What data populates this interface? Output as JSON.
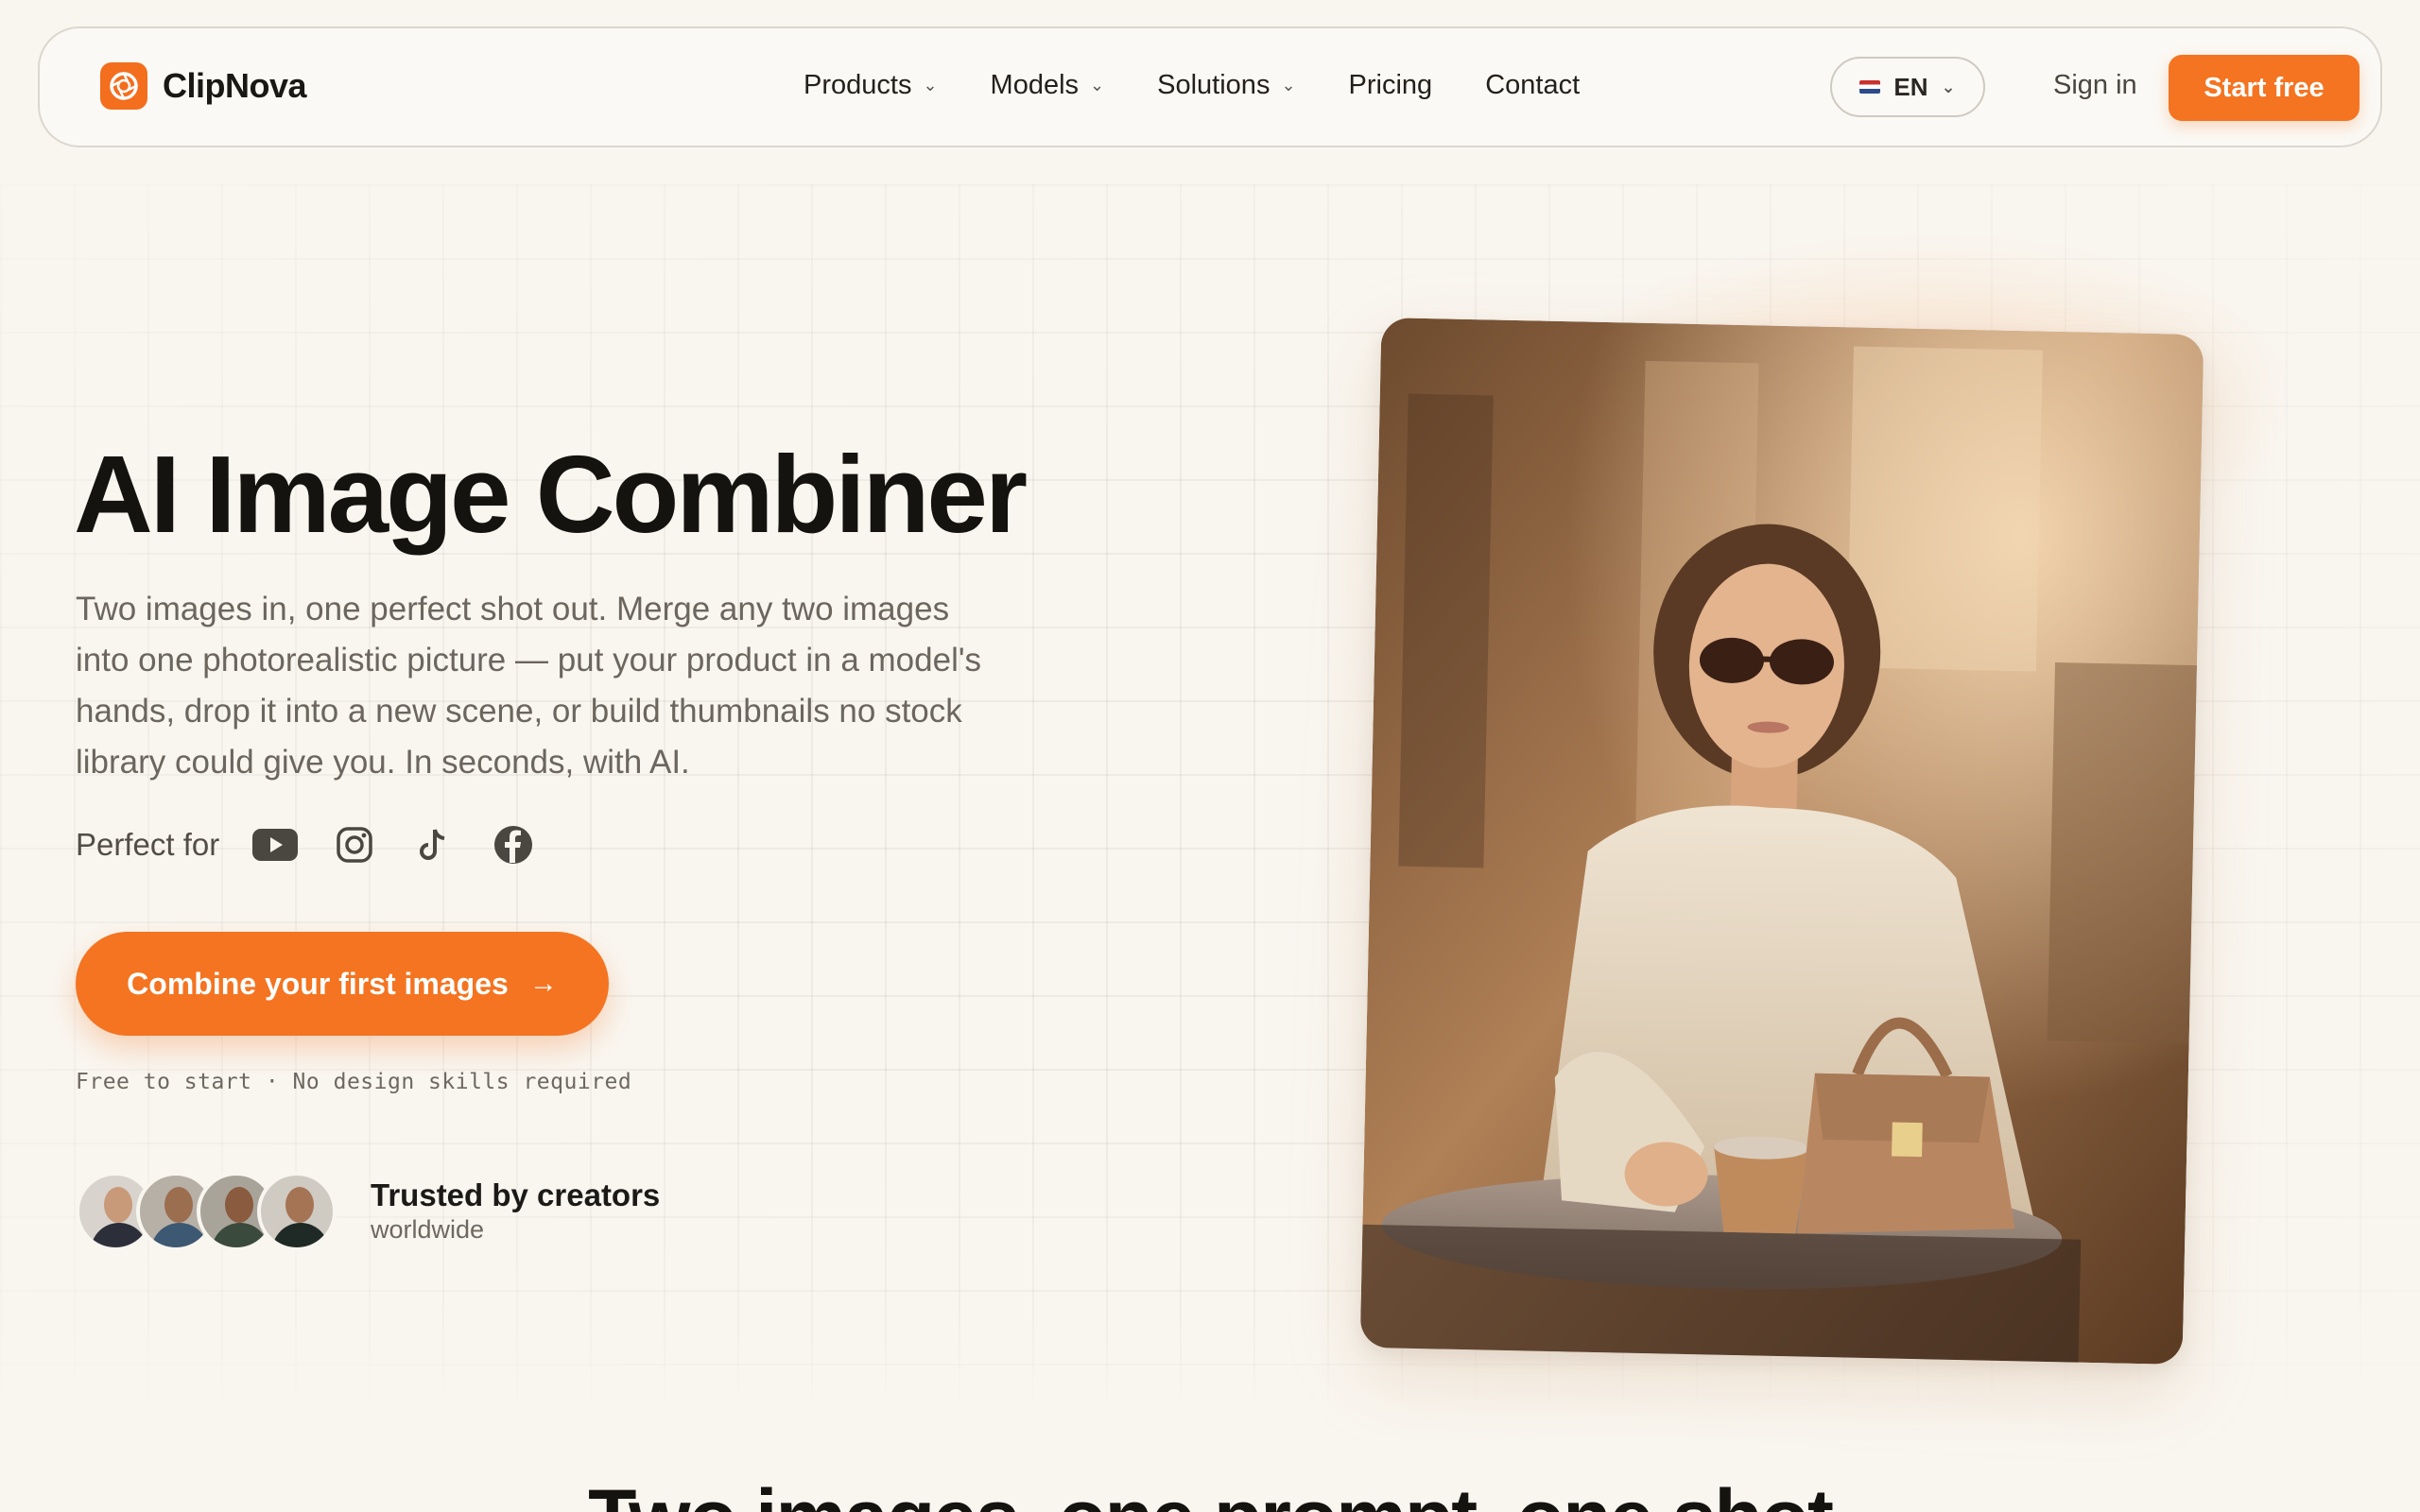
{
  "nav": {
    "brand": "ClipNova",
    "items": [
      {
        "label": "Products",
        "has_dropdown": true
      },
      {
        "label": "Models",
        "has_dropdown": true
      },
      {
        "label": "Solutions",
        "has_dropdown": true
      },
      {
        "label": "Pricing",
        "has_dropdown": false
      },
      {
        "label": "Contact",
        "has_dropdown": false
      }
    ],
    "language": "EN",
    "sign_in": "Sign in",
    "start_free": "Start free"
  },
  "hero": {
    "title": "AI Image Combiner",
    "subtitle": "Two images in, one perfect shot out. Merge any two images into one photorealistic picture — put your product in a model's hands, drop it into a new scene, or build thumbnails no stock library could give you. In seconds, with AI.",
    "perfect_for_label": "Perfect for",
    "platform_icons": [
      "youtube-icon",
      "instagram-icon",
      "tiktok-icon",
      "facebook-icon"
    ],
    "cta_label": "Combine your first images",
    "cta_arrow": "→",
    "note": "Free to start · No design skills required",
    "trusted_title": "Trusted by creators",
    "trusted_sub": "worldwide"
  },
  "next_section": {
    "title": "Two images, one prompt, one shot"
  },
  "colors": {
    "accent": "#f47421",
    "background": "#f9f6f0",
    "text": "#15130f"
  }
}
